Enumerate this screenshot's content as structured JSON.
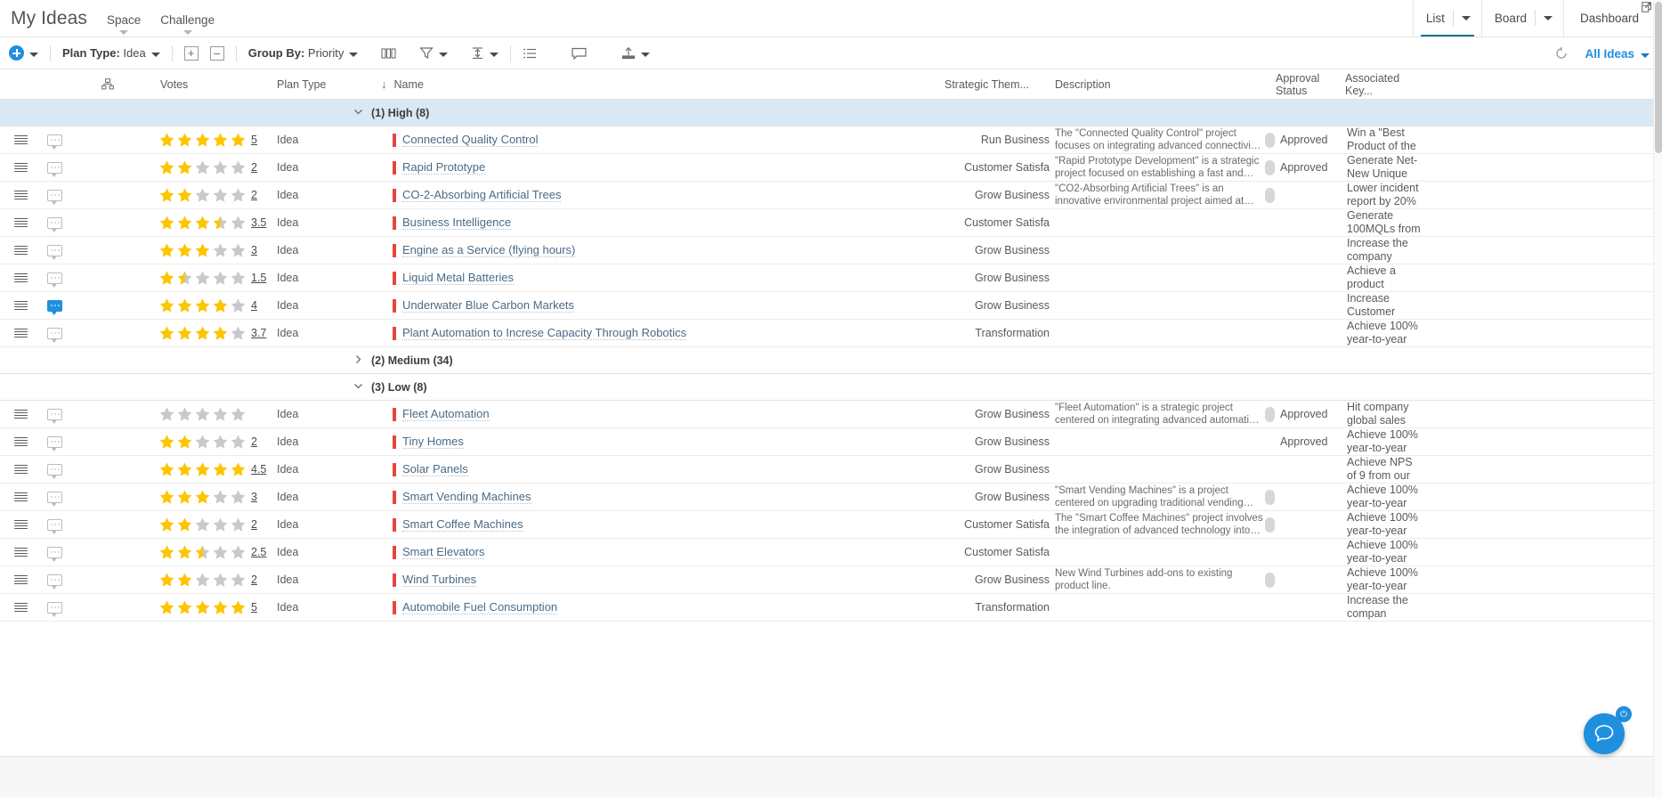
{
  "header": {
    "app_title": "My Ideas",
    "nav_tabs": [
      {
        "label": "Space",
        "icon": "chevron-down-icon"
      },
      {
        "label": "Challenge",
        "icon": "chevron-down-icon"
      }
    ],
    "view_tabs": [
      {
        "label": "List",
        "active": true,
        "has_caret": true
      },
      {
        "label": "Board",
        "active": false,
        "has_caret": true
      },
      {
        "label": "Dashboard",
        "active": false,
        "has_caret": false
      }
    ],
    "expand_icon": "expand-window-icon"
  },
  "toolbar": {
    "add_label": "",
    "plan_type_label": "Plan Type:",
    "plan_type_value": "Idea",
    "expand_all_icon": "expand-rows-icon",
    "collapse_all_icon": "collapse-rows-icon",
    "group_by_label": "Group By:",
    "group_by_value": "Priority",
    "columns_icon": "columns-icon",
    "filter_icon": "filter-icon",
    "row-height_icon": "row-height-icon",
    "list_icon": "list-view-icon",
    "comment_icon": "comment-icon",
    "export_icon": "export-icon",
    "refresh_icon": "refresh-icon",
    "saved_view": "All Ideas"
  },
  "columns": [
    {
      "key": "hierarchy",
      "label": "",
      "icon": "hierarchy-icon"
    },
    {
      "key": "votes",
      "label": "Votes"
    },
    {
      "key": "plan_type",
      "label": "Plan Type"
    },
    {
      "key": "name",
      "label": "Name",
      "sorted": true,
      "sort_icon": "sort-descending-icon"
    },
    {
      "key": "strategic_theme",
      "label": "Strategic Them..."
    },
    {
      "key": "description",
      "label": "Description"
    },
    {
      "key": "approval_status",
      "label": "Approval Status"
    },
    {
      "key": "associated_key_results",
      "label": "Associated Key..."
    }
  ],
  "groups": [
    {
      "label": "(1) High (8)",
      "expanded": true,
      "highlighted": true,
      "collapse_icon": "chevron-down-icon",
      "rows": [
        {
          "has_comment": false,
          "votes": "5",
          "stars": 5,
          "plan_type": "Idea",
          "name": "Connected Quality Control",
          "strategic_theme": "Run Business",
          "description": "The \"Connected Quality Control\" project focuses on integrating advanced connectivity and data",
          "approval_dot": true,
          "approval_status": "Approved",
          "key_result": "Win a \"Best Product of the"
        },
        {
          "has_comment": false,
          "votes": "2",
          "stars": 2,
          "plan_type": "Idea",
          "name": "Rapid Prototype",
          "strategic_theme": "Customer Satisfa",
          "description": "\"Rapid Prototype Development\" is a strategic project focused on establishing a fast and efficient",
          "approval_dot": true,
          "approval_status": "Approved",
          "key_result": "Generate Net-New Unique"
        },
        {
          "has_comment": false,
          "votes": "2",
          "stars": 2,
          "plan_type": "Idea",
          "name": "CO-2-Absorbing Artificial Trees",
          "strategic_theme": "Grow Business",
          "description": "\"CO2-Absorbing Artificial Trees\" is an innovative environmental project aimed at mitigating climate",
          "approval_dot": true,
          "approval_status": "",
          "key_result": "Lower incident report by 20%"
        },
        {
          "has_comment": false,
          "votes": "3.5",
          "stars": 3.5,
          "plan_type": "Idea",
          "name": "Business Intelligence",
          "strategic_theme": "Customer Satisfa",
          "description": "",
          "approval_dot": false,
          "approval_status": "",
          "key_result": "Generate 100MQLs from"
        },
        {
          "has_comment": false,
          "votes": "3",
          "stars": 3,
          "plan_type": "Idea",
          "name": "Engine as a Service (flying hours)",
          "strategic_theme": "Grow Business",
          "description": "",
          "approval_dot": false,
          "approval_status": "",
          "key_result": "Increase the company"
        },
        {
          "has_comment": false,
          "votes": "1.5",
          "stars": 1.5,
          "plan_type": "Idea",
          "name": "Liquid Metal Batteries",
          "strategic_theme": "Grow Business",
          "description": "",
          "approval_dot": false,
          "approval_status": "",
          "key_result": "Achieve a product"
        },
        {
          "has_comment": true,
          "votes": "4",
          "stars": 4,
          "plan_type": "Idea",
          "name": "Underwater Blue Carbon Markets",
          "strategic_theme": "Grow Business",
          "description": "",
          "approval_dot": false,
          "approval_status": "",
          "key_result": "Increase Customer"
        },
        {
          "has_comment": false,
          "votes": "3.7",
          "stars": 4,
          "plan_type": "Idea",
          "name": "Plant Automation to Increse Capacity Through Robotics",
          "strategic_theme": "Transformation",
          "description": "",
          "approval_dot": false,
          "approval_status": "",
          "key_result": "Achieve 100% year-to-year"
        }
      ]
    },
    {
      "label": "(2) Medium (34)",
      "expanded": false,
      "highlighted": false,
      "collapse_icon": "chevron-right-icon",
      "rows": []
    },
    {
      "label": "(3) Low (8)",
      "expanded": true,
      "highlighted": false,
      "collapse_icon": "chevron-down-icon",
      "rows": [
        {
          "has_comment": false,
          "votes": "",
          "stars": 0,
          "plan_type": "Idea",
          "name": "Fleet Automation",
          "strategic_theme": "Grow Business",
          "description": "\"Fleet Automation\" is a strategic project centered on integrating advanced automation technologies",
          "approval_dot": true,
          "approval_status": "Approved",
          "key_result": "Hit company global sales"
        },
        {
          "has_comment": false,
          "votes": "2",
          "stars": 2,
          "plan_type": "Idea",
          "name": "Tiny Homes",
          "strategic_theme": "Grow Business",
          "description": "",
          "approval_dot": false,
          "approval_status": "Approved",
          "key_result": "Achieve 100% year-to-year"
        },
        {
          "has_comment": false,
          "votes": "4.5",
          "stars": 5,
          "plan_type": "Idea",
          "name": "Solar Panels",
          "strategic_theme": "Grow Business",
          "description": "",
          "approval_dot": false,
          "approval_status": "",
          "key_result": "Achieve NPS of 9 from our"
        },
        {
          "has_comment": false,
          "votes": "3",
          "stars": 3,
          "plan_type": "Idea",
          "name": "Smart Vending Machines",
          "strategic_theme": "Grow Business",
          "description": "\"Smart Vending Machines\" is a project centered on upgrading traditional vending machines with",
          "approval_dot": true,
          "approval_status": "",
          "key_result": "Achieve 100% year-to-year"
        },
        {
          "has_comment": false,
          "votes": "2",
          "stars": 2,
          "plan_type": "Idea",
          "name": "Smart Coffee Machines",
          "strategic_theme": "Customer Satisfa",
          "description": "The \"Smart Coffee Machines\" project involves the integration of advanced technology into coffee",
          "approval_dot": true,
          "approval_status": "",
          "key_result": "Achieve 100% year-to-year"
        },
        {
          "has_comment": false,
          "votes": "2.5",
          "stars": 2.5,
          "plan_type": "Idea",
          "name": "Smart Elevators",
          "strategic_theme": "Customer Satisfa",
          "description": "",
          "approval_dot": false,
          "approval_status": "",
          "key_result": "Achieve 100% year-to-year"
        },
        {
          "has_comment": false,
          "votes": "2",
          "stars": 2,
          "plan_type": "Idea",
          "name": "Wind Turbines",
          "strategic_theme": "Grow Business",
          "description": "New Wind Turbines add-ons to existing product line.",
          "approval_dot": true,
          "approval_status": "",
          "key_result": "Achieve 100% year-to-year"
        },
        {
          "has_comment": false,
          "votes": "5",
          "stars": 5,
          "plan_type": "Idea",
          "name": "Automobile Fuel Consumption",
          "strategic_theme": "Transformation",
          "description": "",
          "approval_dot": false,
          "approval_status": "",
          "key_result": "Increase the compan"
        }
      ]
    }
  ],
  "fab": {
    "icon": "chat-support-icon",
    "badge_icon": "power-icon"
  },
  "colors": {
    "accent": "#1f8fe0",
    "star_filled": "#fdc500",
    "star_empty": "#c9c9c9",
    "name_bar": "#e8453c",
    "group_highlight": "#d9e8f5",
    "active_tab_underline": "#1a6fa8"
  }
}
